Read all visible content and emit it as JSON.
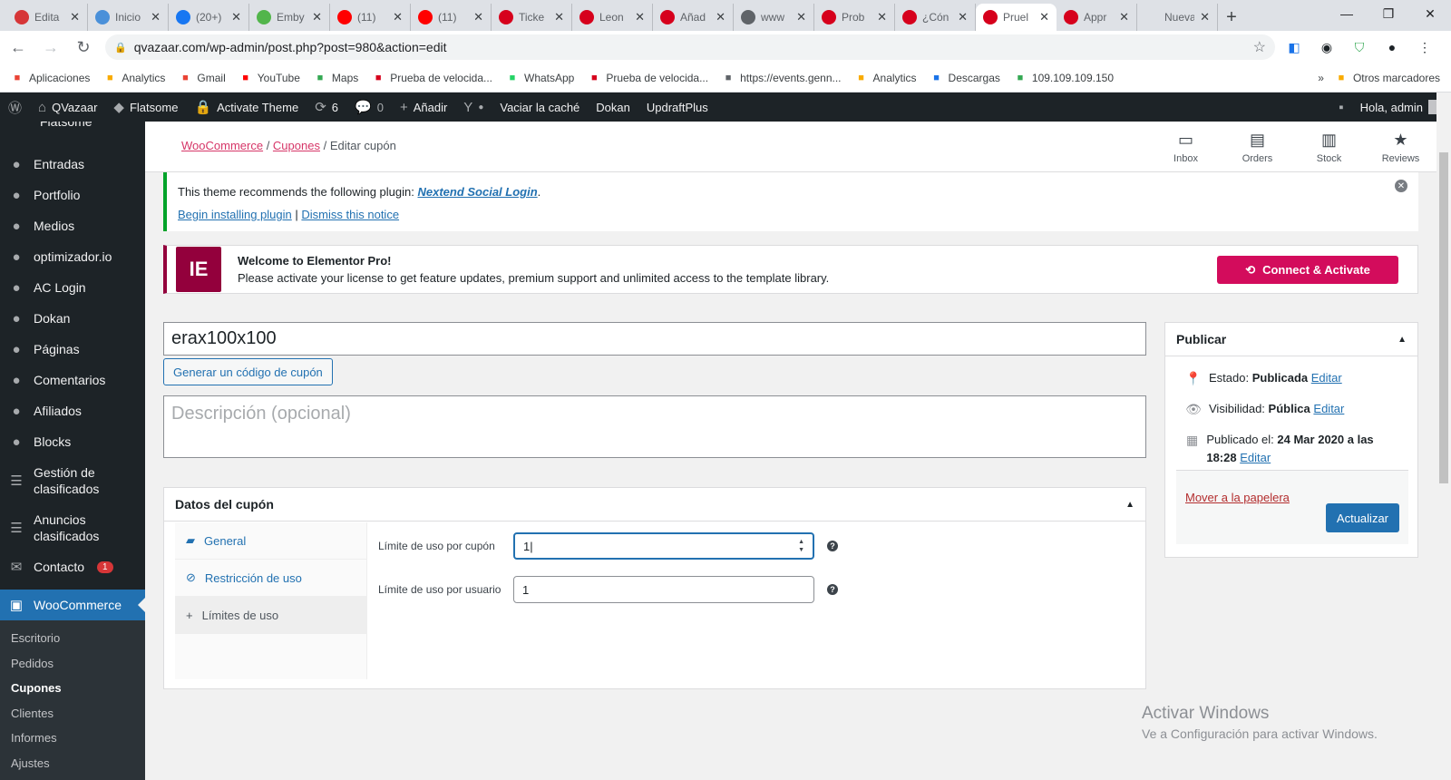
{
  "browser": {
    "tabs": [
      {
        "title": "Edita",
        "color": "#d63638",
        "active": false
      },
      {
        "title": "Inicio",
        "color": "#4a90d9",
        "active": false
      },
      {
        "title": "(20+)",
        "color": "#1877f2",
        "active": false
      },
      {
        "title": "Emby",
        "color": "#52b54b",
        "active": false
      },
      {
        "title": "(11)",
        "color": "#ff0000",
        "active": false
      },
      {
        "title": "(11)",
        "color": "#ff0000",
        "active": false
      },
      {
        "title": "Ticke",
        "color": "#d6001c",
        "active": false
      },
      {
        "title": "Leon",
        "color": "#d6001c",
        "active": false
      },
      {
        "title": "Añad",
        "color": "#d6001c",
        "active": false
      },
      {
        "title": "www",
        "color": "#5f6368",
        "active": false
      },
      {
        "title": "Prob",
        "color": "#d6001c",
        "active": false
      },
      {
        "title": "¿Cón",
        "color": "#d6001c",
        "active": false
      },
      {
        "title": "Pruel",
        "color": "#d6001c",
        "active": true
      },
      {
        "title": "Appr",
        "color": "#d6001c",
        "active": false
      },
      {
        "title": "Nueva pe",
        "color": "#ffffff",
        "active": false
      }
    ],
    "url": "qvazaar.com/wp-admin/post.php?post=980&action=edit",
    "bookmarks": [
      {
        "label": "Aplicaciones",
        "icon": "apps-grid-icon",
        "color": "#ea4335"
      },
      {
        "label": "Analytics",
        "icon": "analytics-icon",
        "color": "#f9ab00"
      },
      {
        "label": "Gmail",
        "icon": "gmail-icon",
        "color": "#ea4335"
      },
      {
        "label": "YouTube",
        "icon": "youtube-icon",
        "color": "#ff0000"
      },
      {
        "label": "Maps",
        "icon": "maps-icon",
        "color": "#34a853"
      },
      {
        "label": "Prueba de velocida...",
        "icon": "speedtest-icon",
        "color": "#d6001c"
      },
      {
        "label": "WhatsApp",
        "icon": "whatsapp-icon",
        "color": "#25d366"
      },
      {
        "label": "Prueba de velocida...",
        "icon": "speedtest-icon",
        "color": "#d6001c"
      },
      {
        "label": "https://events.genn...",
        "icon": "page-icon",
        "color": "#5f6368"
      },
      {
        "label": "Analytics",
        "icon": "analytics-icon",
        "color": "#f9ab00"
      },
      {
        "label": "Descargas",
        "icon": "download-icon",
        "color": "#1a73e8"
      },
      {
        "label": "109.109.109.150",
        "icon": "diamond-icon",
        "color": "#34a853"
      }
    ],
    "other_bookmarks": "Otros marcadores"
  },
  "adminbar": {
    "site": "QVazaar",
    "flatsome": "Flatsome",
    "activate": "Activate Theme",
    "updates": "6",
    "comments": "0",
    "add": "Añadir",
    "cache": "Vaciar la caché",
    "dokan": "Dokan",
    "updraft": "UpdraftPlus",
    "greeting": "Hola, admin"
  },
  "sidebar": {
    "partial_top": "Flatsome",
    "items": [
      {
        "label": "Entradas",
        "icon": "pin-icon"
      },
      {
        "label": "Portfolio",
        "icon": "portfolio-icon"
      },
      {
        "label": "Medios",
        "icon": "media-icon"
      },
      {
        "label": "optimizador.io",
        "icon": "gauge-icon"
      },
      {
        "label": "AC Login",
        "icon": "login-icon"
      },
      {
        "label": "Dokan",
        "icon": "dokan-icon"
      },
      {
        "label": "Páginas",
        "icon": "page-icon"
      },
      {
        "label": "Comentarios",
        "icon": "comment-icon"
      },
      {
        "label": "Afiliados",
        "icon": "users-icon"
      },
      {
        "label": "Blocks",
        "icon": "blocks-icon"
      }
    ],
    "gestion": "Gestión de clasificados",
    "anuncios": "Anuncios clasificados",
    "contacto": "Contacto",
    "contacto_badge": "1",
    "woocommerce": "WooCommerce",
    "submenu": [
      "Escritorio",
      "Pedidos",
      "Cupones",
      "Clientes",
      "Informes",
      "Ajustes"
    ],
    "current_sub": "Cupones"
  },
  "wc_header": {
    "crumb1": "WooCommerce",
    "crumb2": "Cupones",
    "crumb3": "Editar cupón",
    "actions": [
      {
        "label": "Inbox",
        "icon": "inbox-icon"
      },
      {
        "label": "Orders",
        "icon": "orders-icon"
      },
      {
        "label": "Stock",
        "icon": "stock-icon"
      },
      {
        "label": "Reviews",
        "icon": "star-icon"
      }
    ]
  },
  "notice": {
    "text": "This theme recommends the following plugin: ",
    "plugin": "Nextend Social Login",
    "begin": "Begin installing plugin",
    "sep": "|",
    "dismiss": "Dismiss this notice"
  },
  "elementor": {
    "title": "Welcome to Elementor Pro!",
    "body": "Please activate your license to get feature updates, premium support and unlimited access to the template library.",
    "button": "Connect & Activate"
  },
  "coupon": {
    "code": "erax100x100",
    "generate": "Generar un código de cupón",
    "desc_placeholder": "Descripción (opcional)",
    "box_title": "Datos del cupón",
    "tabs": [
      "General",
      "Restricción de uso",
      "Límites de uso"
    ],
    "fields": [
      {
        "label": "Límite de uso por cupón",
        "value": "1"
      },
      {
        "label": "Límite de uso por usuario",
        "value": "1"
      }
    ]
  },
  "publish": {
    "title": "Publicar",
    "estado_label": "Estado: ",
    "estado": "Publicada",
    "visib_label": "Visibilidad: ",
    "visib": "Pública",
    "pub_label": "Publicado el: ",
    "pub_date": "24 Mar 2020 a las 18:28",
    "edit": "Editar",
    "trash": "Mover a la papelera",
    "update": "Actualizar"
  },
  "windows": {
    "line1": "Activar Windows",
    "line2": "Ve a Configuración para activar Windows."
  }
}
